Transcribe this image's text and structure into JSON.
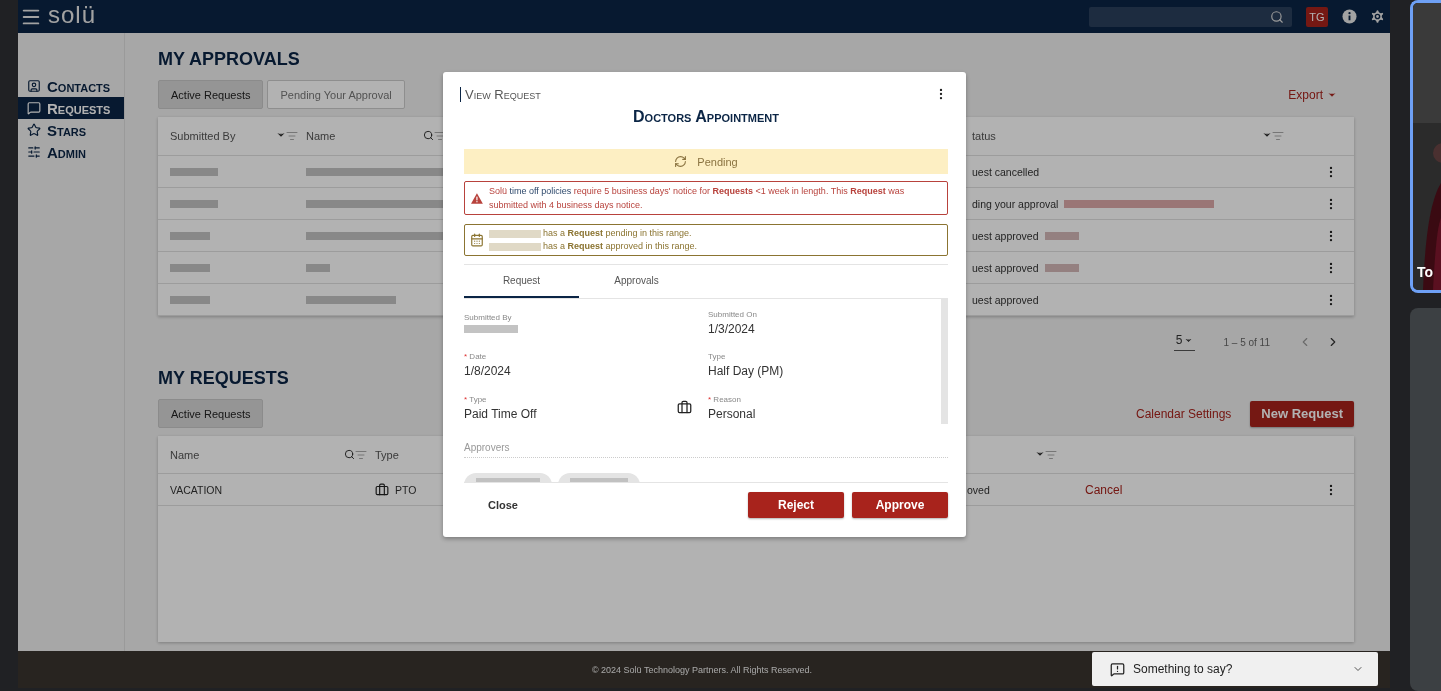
{
  "app_bar": {
    "logo": "solü",
    "avatar": "TG"
  },
  "sidebar": {
    "items": [
      {
        "label": "Contacts",
        "selected": false
      },
      {
        "label": "Requests",
        "selected": true
      },
      {
        "label": "Stars",
        "selected": false
      },
      {
        "label": "Admin",
        "selected": false
      }
    ]
  },
  "approvals": {
    "title": "MY APPROVALS",
    "tabs": [
      {
        "label": "Active Requests",
        "selected": true
      },
      {
        "label": "Pending Your Approval",
        "selected": false
      }
    ],
    "export": "Export",
    "columns": [
      "Submitted By",
      "Name",
      "tatus"
    ],
    "rows": [
      {
        "status": "uest cancelled"
      },
      {
        "status": "ding your approval"
      },
      {
        "status": "uest approved"
      },
      {
        "status": "uest approved"
      },
      {
        "status": "uest approved"
      }
    ],
    "pagination": {
      "page_size": "5",
      "range": "1 – 5 of 11"
    }
  },
  "requests": {
    "title": "MY REQUESTS",
    "tabs": [
      {
        "label": "Active Requests",
        "selected": true
      }
    ],
    "calendar_settings": "Calendar Settings",
    "new_request": "New Request",
    "columns": [
      "Name",
      "Type"
    ],
    "rows": [
      {
        "name": "VACATION",
        "type": "PTO",
        "status": "oved",
        "action": "Cancel"
      }
    ]
  },
  "footer": {
    "copyright": "© 2024 Solü Technology Partners. All Rights Reserved.",
    "feedback": "Something to say?"
  },
  "modal": {
    "eyebrow": "View Request",
    "title": "Doctors Appointment",
    "status": "Pending",
    "warning": {
      "before": "Solü ",
      "link": "time off policies",
      "after": " require 5 business days' notice for **Requests** <1 week in length. This **Request** was submitted with 4 business days notice."
    },
    "conflicts": [
      {
        "text": "has a **Request** pending in this range."
      },
      {
        "text": "has a **Request** approved in this range."
      }
    ],
    "tabs": [
      {
        "label": "Request",
        "selected": true
      },
      {
        "label": "Approvals",
        "selected": false
      }
    ],
    "fields": [
      {
        "label": "Submitted By",
        "kind": "redacted"
      },
      {
        "label": "Submitted On",
        "kind": "text",
        "value": "1/3/2024"
      },
      {
        "label": "Date",
        "kind": "text",
        "value": "1/8/2024",
        "required_mark": "*"
      },
      {
        "label": "Type",
        "kind": "text",
        "value": "Half Day (PM)"
      },
      {
        "label": "Type",
        "kind": "icon",
        "value": "Paid Time Off",
        "required_mark": "*"
      },
      {
        "label": "Reason",
        "kind": "text",
        "value": "Personal",
        "required_mark": "*"
      }
    ],
    "approvers_label": "Approvers",
    "close": "Close",
    "reject": "Reject",
    "approve": "Approve"
  },
  "video_tile": {
    "label": "To"
  }
}
